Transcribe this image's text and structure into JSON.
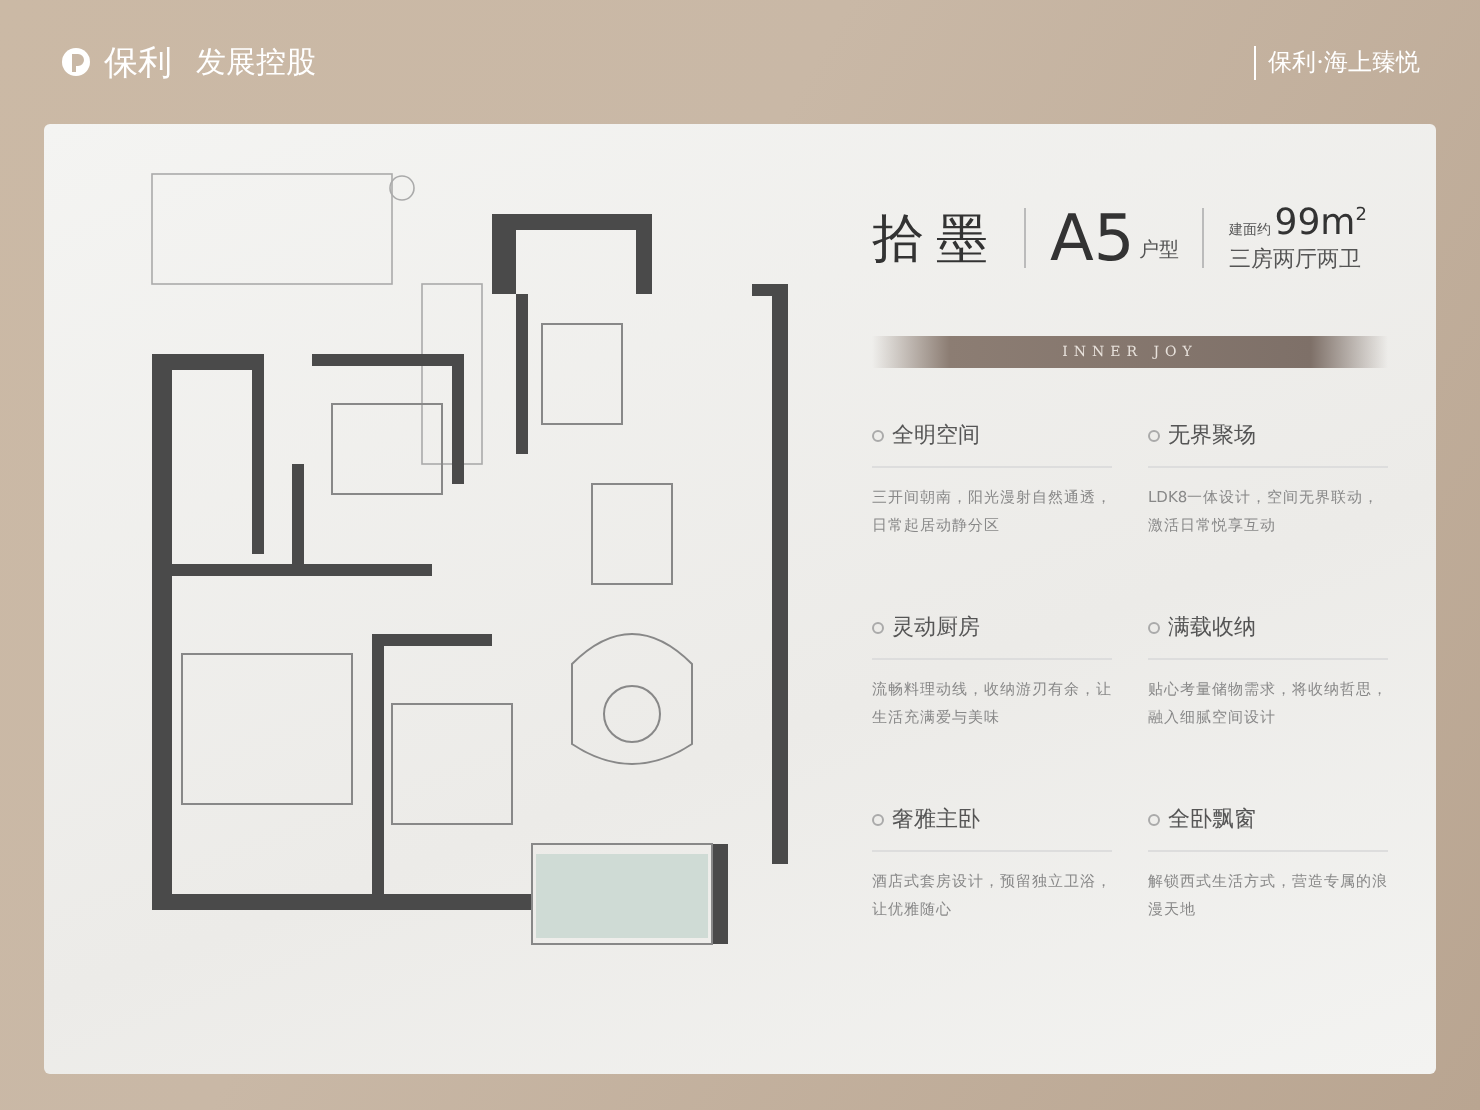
{
  "header": {
    "brand": "保利",
    "brand_sub": "发展控股",
    "project": "保利·海上臻悦"
  },
  "title": {
    "name": "拾墨",
    "unit": "A5",
    "unit_suffix": "户型",
    "area_prefix": "建面约",
    "area": "99m$^{2}$",
    "layout": "三房两厅两卫"
  },
  "banner": "INNER JOY",
  "features": [
    {
      "title": "全明空间",
      "text": "三开间朝南，阳光漫射自然通透，日常起居动静分区"
    },
    {
      "title": "无界聚场",
      "text": "LDK8一体设计，空间无界联动，激活日常悦享互动"
    },
    {
      "title": "灵动厨房",
      "text": "流畅料理动线，收纳游刃有余，让生活充满爱与美味"
    },
    {
      "title": "满载收纳",
      "text": "贴心考量储物需求，将收纳哲思，融入细腻空间设计"
    },
    {
      "title": "奢雅主卧",
      "text": "酒店式套房设计，预留独立卫浴，让优雅随心"
    },
    {
      "title": "全卧飘窗",
      "text": "解锁西式生活方式，营造专属的浪漫天地"
    }
  ]
}
